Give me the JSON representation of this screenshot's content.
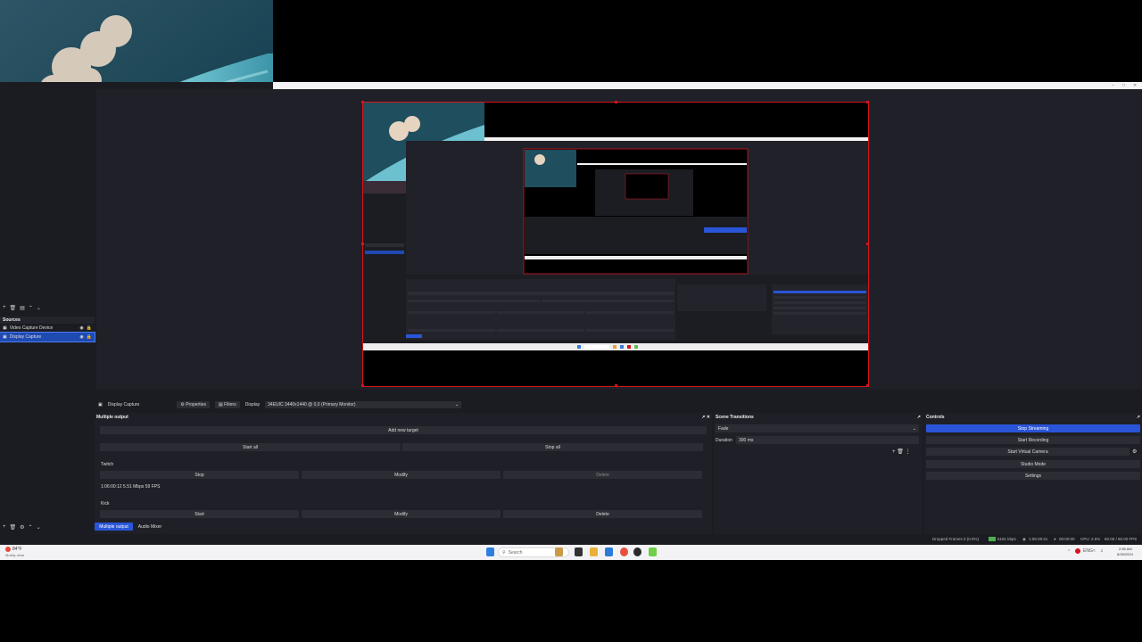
{
  "sources": {
    "title": "Sources",
    "items": [
      {
        "label": "Video Capture Device",
        "selected": false
      },
      {
        "label": "Display Capture",
        "selected": true
      }
    ]
  },
  "context_bar": {
    "source_name": "Display Capture",
    "properties_label": "Properties",
    "filters_label": "Filters",
    "display_label": "Display",
    "display_value": "34EUIC 3440x1440 @ 0,0 (Primary Monitor)"
  },
  "multiple_output": {
    "title": "Multiple output",
    "add_target_label": "Add new target",
    "start_all_label": "Start all",
    "stop_all_label": "Stop all",
    "targets": [
      {
        "name": "Twitch",
        "primary_label": "Stop",
        "modify_label": "Modify",
        "delete_label": "Delete",
        "stats": "1:06:00:12  5.51 Mbps  59 FPS"
      },
      {
        "name": "Kick",
        "primary_label": "Start",
        "modify_label": "Modify",
        "delete_label": "Delete",
        "stats": ""
      }
    ]
  },
  "dock_tabs": {
    "tab1": "Multiple output",
    "tab2": "Audio Mixer"
  },
  "scene_transitions": {
    "title": "Scene Transitions",
    "transition": "Fade",
    "duration_label": "Duration",
    "duration_value": "300 ms"
  },
  "controls": {
    "title": "Controls",
    "stop_streaming": "Stop Streaming",
    "start_recording": "Start Recording",
    "start_virtual_camera": "Start Virtual Camera",
    "studio_mode": "Studio Mode",
    "settings": "Settings"
  },
  "status_bar": {
    "dropped_frames": "Dropped Frames 0 (0.0%)",
    "bitrate": "6181 kbps",
    "stream_time": "1:06:29:41",
    "record_time": "00:00:00",
    "cpu": "CPU: 2.6%",
    "fps": "60.00 / 60.00 FPS"
  },
  "taskbar": {
    "weather_temp": "84°F",
    "weather_desc": "Mostly clear",
    "search_placeholder": "Search",
    "lang": "ENG",
    "time": "2:55 AM",
    "date": "6/28/2024"
  },
  "colors": {
    "accent": "#2a55d8",
    "preview_border": "#d6141e",
    "panel": "#1f2027"
  }
}
